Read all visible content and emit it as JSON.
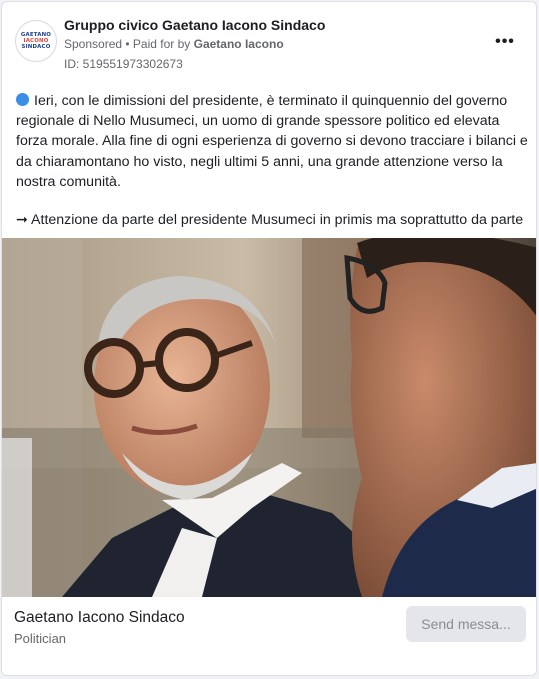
{
  "header": {
    "page_name": "Gruppo civico Gaetano Iacono Sindaco",
    "sponsored_label": "Sponsored",
    "separator": " • ",
    "paid_for_prefix": "Paid for by ",
    "paid_for_name": "Gaetano Iacono",
    "ad_id": "ID: 519551973302673",
    "more_label": "•••",
    "avatar_logo_text": [
      "GAETANO",
      "IACONO",
      "SINDACO"
    ]
  },
  "post": {
    "paragraph_1": "Ieri, con le dimissioni del presidente, è terminato il quinquennio del governo regionale di Nello Musumeci, un uomo di grande spessore politico ed elevata forza morale. Alla fine di ogni esperienza di governo si devono tracciare i bilanci e da chiaramontano ho visto, negli ultimi 5 anni, una grande attenzione verso la nostra comunità.",
    "paragraph_2": "➞ Attenzione da parte del presidente Musumeci in primis ma soprattutto da parte"
  },
  "footer": {
    "title": "Gaetano Iacono Sindaco",
    "subtitle": "Politician",
    "send_button": "Send messa..."
  },
  "colors": {
    "accent_blue_dot": "#3a8ee6",
    "button_bg": "#e4e6eb",
    "secondary_text": "#65676b"
  },
  "icons": {
    "bullet": "blue-circle-icon",
    "more": "more-options-icon"
  }
}
